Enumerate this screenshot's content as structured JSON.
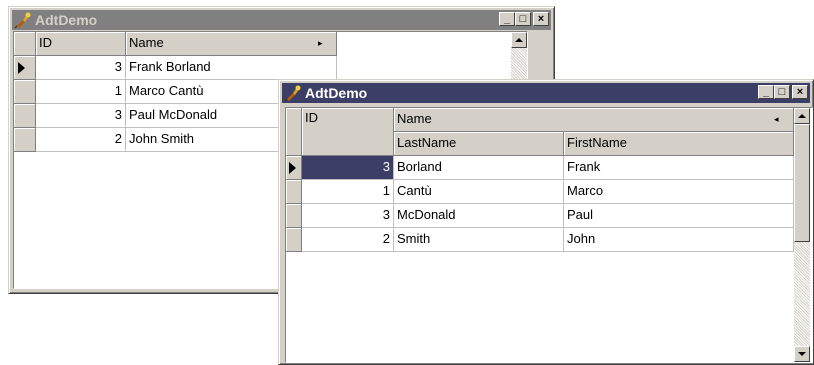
{
  "window_back": {
    "title": "AdtDemo",
    "columns": [
      "ID",
      "Name"
    ],
    "column_marker": "▸",
    "rows": [
      {
        "id": "3",
        "name": "Frank Borland"
      },
      {
        "id": "1",
        "name": "Marco Cantù"
      },
      {
        "id": "3",
        "name": "Paul McDonald"
      },
      {
        "id": "2",
        "name": "John Smith"
      }
    ]
  },
  "window_front": {
    "title": "AdtDemo",
    "columns": {
      "id": "ID",
      "group": "Name",
      "group_marker": "◂",
      "sub": [
        "LastName",
        "FirstName"
      ]
    },
    "rows": [
      {
        "id": "3",
        "last": "Borland",
        "first": "Frank"
      },
      {
        "id": "1",
        "last": "Cantù",
        "first": "Marco"
      },
      {
        "id": "3",
        "last": "McDonald",
        "first": "Paul"
      },
      {
        "id": "2",
        "last": "Smith",
        "first": "John"
      }
    ]
  },
  "window_buttons": {
    "minimize": "_",
    "maximize": "□",
    "close": "×"
  },
  "colors": {
    "active_title": "#3b3e66",
    "inactive_title": "#808080",
    "face": "#d4d0c8"
  }
}
